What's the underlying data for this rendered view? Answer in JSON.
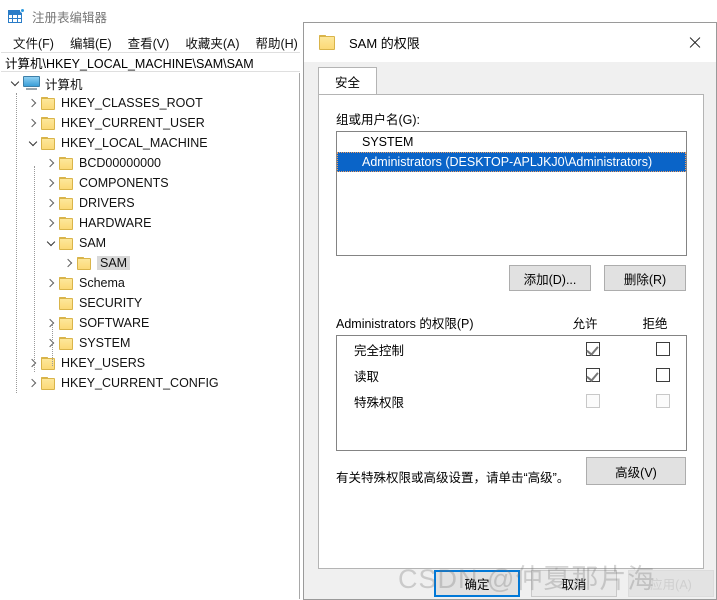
{
  "app": {
    "title": "注册表编辑器",
    "icon": "registry-editor-icon",
    "menu": [
      {
        "label": "文件(F)"
      },
      {
        "label": "编辑(E)"
      },
      {
        "label": "查看(V)"
      },
      {
        "label": "收藏夹(A)"
      },
      {
        "label": "帮助(H)"
      }
    ],
    "address": "计算机\\HKEY_LOCAL_MACHINE\\SAM\\SAM"
  },
  "tree": [
    {
      "label": "计算机",
      "depth": 0,
      "icon": "computer-icon",
      "expander": "down",
      "selected": false
    },
    {
      "label": "HKEY_CLASSES_ROOT",
      "depth": 1,
      "icon": "folder-icon",
      "expander": "right",
      "selected": false
    },
    {
      "label": "HKEY_CURRENT_USER",
      "depth": 1,
      "icon": "folder-icon",
      "expander": "right",
      "selected": false
    },
    {
      "label": "HKEY_LOCAL_MACHINE",
      "depth": 1,
      "icon": "folder-icon",
      "expander": "down",
      "selected": false
    },
    {
      "label": "BCD00000000",
      "depth": 2,
      "icon": "folder-icon",
      "expander": "right",
      "selected": false
    },
    {
      "label": "COMPONENTS",
      "depth": 2,
      "icon": "folder-icon",
      "expander": "right",
      "selected": false
    },
    {
      "label": "DRIVERS",
      "depth": 2,
      "icon": "folder-icon",
      "expander": "right",
      "selected": false
    },
    {
      "label": "HARDWARE",
      "depth": 2,
      "icon": "folder-icon",
      "expander": "right",
      "selected": false
    },
    {
      "label": "SAM",
      "depth": 2,
      "icon": "folder-icon",
      "expander": "down",
      "selected": false
    },
    {
      "label": "SAM",
      "depth": 3,
      "icon": "folder-icon",
      "expander": "right",
      "selected": true
    },
    {
      "label": "Schema",
      "depth": 2,
      "icon": "folder-icon",
      "expander": "right",
      "selected": false
    },
    {
      "label": "SECURITY",
      "depth": 2,
      "icon": "folder-icon",
      "expander": "none",
      "selected": false
    },
    {
      "label": "SOFTWARE",
      "depth": 2,
      "icon": "folder-icon",
      "expander": "right",
      "selected": false
    },
    {
      "label": "SYSTEM",
      "depth": 2,
      "icon": "folder-icon",
      "expander": "right",
      "selected": false
    },
    {
      "label": "HKEY_USERS",
      "depth": 1,
      "icon": "folder-icon",
      "expander": "right",
      "selected": false
    },
    {
      "label": "HKEY_CURRENT_CONFIG",
      "depth": 1,
      "icon": "folder-icon",
      "expander": "right",
      "selected": false
    }
  ],
  "dialog": {
    "title": "SAM 的权限",
    "title_icon": "folder-icon",
    "close_icon": "close-icon",
    "tab": {
      "label": "安全"
    },
    "groups_label": "组或用户名(G):",
    "users": [
      {
        "name": "SYSTEM",
        "selected": false,
        "icon": "group-icon"
      },
      {
        "name": "Administrators (DESKTOP-APLJKJ0\\Administrators)",
        "selected": true,
        "icon": "group-icon"
      }
    ],
    "add_button": "添加(D)...",
    "remove_button": "删除(R)",
    "perm_header": "Administrators 的权限(P)",
    "col_allow": "允许",
    "col_deny": "拒绝",
    "permissions": [
      {
        "name": "完全控制",
        "allow": true,
        "deny": false,
        "disabled": false
      },
      {
        "name": "读取",
        "allow": true,
        "deny": false,
        "disabled": false
      },
      {
        "name": "特殊权限",
        "allow": false,
        "deny": false,
        "disabled": true
      }
    ],
    "advanced_note": "有关特殊权限或高级设置，请单击“高级”。",
    "advanced_button": "高级(V)",
    "ok_button": "确定",
    "cancel_button": "取消",
    "apply_button": "应用(A)"
  },
  "watermark": {
    "text": "CSDN @仲夏那片海"
  },
  "colors": {
    "accent": "#0078d7",
    "selection": "#0a64c8",
    "folder": "#fbd977",
    "window_bg": "#f0f0f0"
  }
}
